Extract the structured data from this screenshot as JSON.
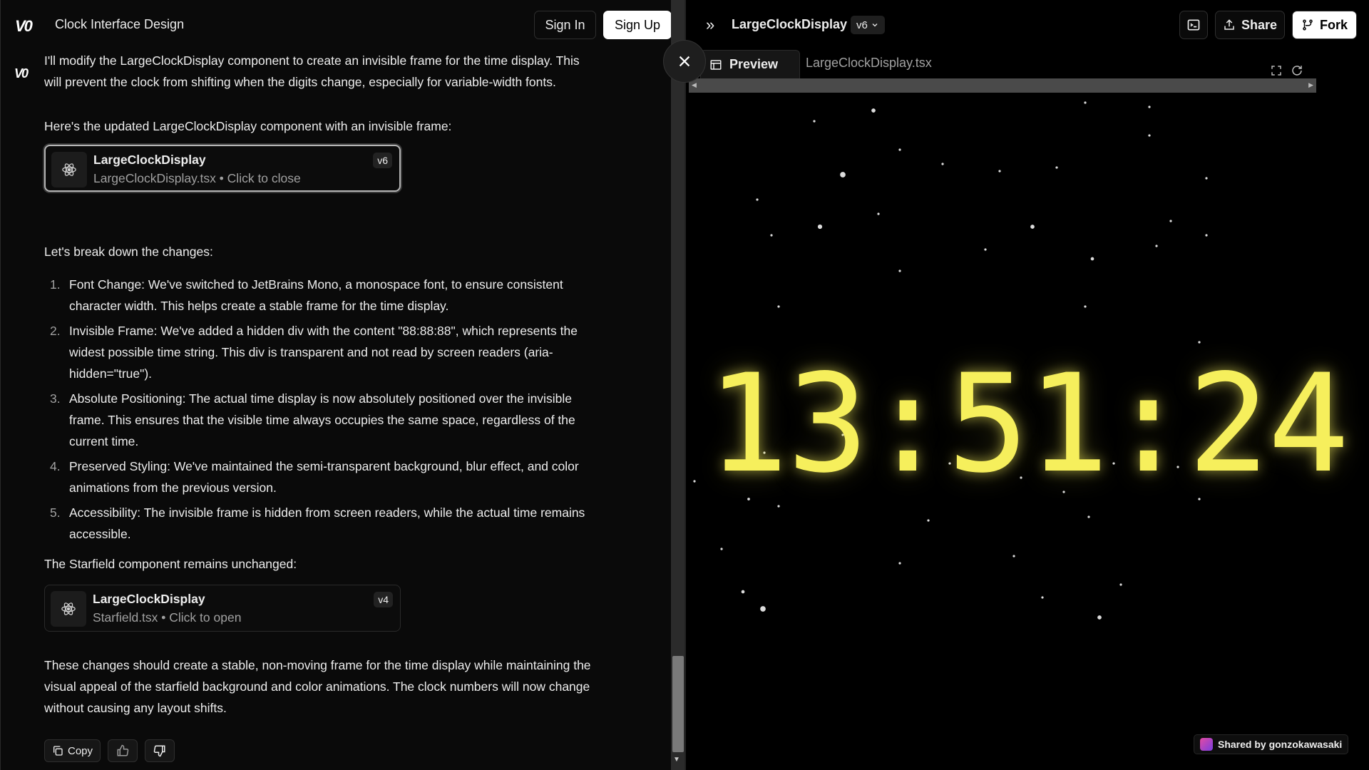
{
  "app": {
    "title": "Clock Interface Design"
  },
  "auth": {
    "sign_in": "Sign In",
    "sign_up": "Sign Up"
  },
  "message": {
    "intro": "I'll modify the LargeClockDisplay component to create an invisible frame for the time display. This will prevent the clock from shifting when the digits change, especially for variable-width fonts.",
    "lead": "Here's the updated LargeClockDisplay component with an invisible frame:",
    "card1": {
      "title": "LargeClockDisplay",
      "subtitle": "LargeClockDisplay.tsx • Click to close",
      "version": "v6"
    },
    "breakdown": "Let's break down the changes:",
    "changes": [
      {
        "num": "1.",
        "text": "Font Change: We've switched to JetBrains Mono, a monospace font, to ensure consistent character width. This helps create a stable frame for the time display."
      },
      {
        "num": "2.",
        "text": "Invisible Frame: We've added a hidden div with the content \"88:88:88\", which represents the widest possible time string. This div is transparent and not read by screen readers (aria-hidden=\"true\")."
      },
      {
        "num": "3.",
        "text": "Absolute Positioning: The actual time display is now absolutely positioned over the invisible frame. This ensures that the visible time always occupies the same space, regardless of the current time."
      },
      {
        "num": "4.",
        "text": "Preserved Styling: We've maintained the semi-transparent background, blur effect, and color animations from the previous version."
      },
      {
        "num": "5.",
        "text": "Accessibility: The invisible frame is hidden from screen readers, while the actual time remains accessible."
      }
    ],
    "starfield_note": "The Starfield component remains unchanged:",
    "card2": {
      "title": "LargeClockDisplay",
      "subtitle": "Starfield.tsx • Click to open",
      "version": "v4"
    },
    "outro": "These changes should create a stable, non-moving frame for the time display while maintaining the visual appeal of the starfield background and color animations. The clock numbers will now change without causing any layout shifts.",
    "actions": {
      "copy": "Copy"
    }
  },
  "preview": {
    "title": "LargeClockDisplay",
    "version": "v6",
    "share": "Share",
    "fork": "Fork",
    "tab_preview": "Preview",
    "tab_file": "LargeClockDisplay.tsx",
    "clock_time": "13:51:24",
    "clock_color": "#f6ef5c",
    "shared_by": "Shared by gonzokawasaki"
  }
}
